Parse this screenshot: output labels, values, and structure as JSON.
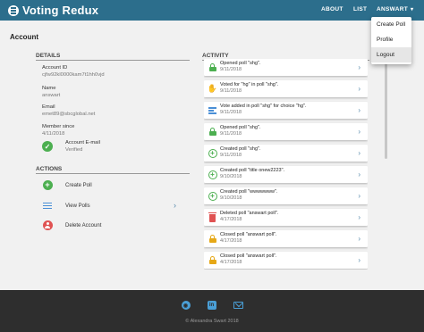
{
  "navbar": {
    "brand": "Voting Redux",
    "links": {
      "about": "ABOUT",
      "list": "LIST",
      "user": "ANSWART"
    }
  },
  "dropdown": {
    "items": [
      "Create Poll",
      "Profile",
      "Logout"
    ],
    "active_item": "Logout"
  },
  "page": {
    "title": "Account"
  },
  "details": {
    "header": "DETAILS",
    "account_id_label": "Account ID",
    "account_id_value": "cjfw92kl0000kam7t1hh0vjd",
    "name_label": "Name",
    "name_value": "answart",
    "email_label": "Email",
    "email_value": "emet89@sbcglobal.net",
    "member_since_label": "Member since",
    "member_since_value": "4/11/2018",
    "email_status_label": "Account E-mail",
    "email_status_value": "Verified"
  },
  "actions": {
    "header": "ACTIONS",
    "items": [
      {
        "label": "Create Poll",
        "icon": "plus-circle-icon"
      },
      {
        "label": "View Polls",
        "icon": "list-icon"
      },
      {
        "label": "Delete Account",
        "icon": "account-remove-icon"
      }
    ]
  },
  "activity": {
    "header": "ACTIVITY",
    "items": [
      {
        "title": "Opened poll \"shg\".",
        "date": "9/11/2018",
        "icon": "lock-open-icon"
      },
      {
        "title": "Voted for \"hg\" in poll \"shg\".",
        "date": "9/11/2018",
        "icon": "vote-hand-icon"
      },
      {
        "title": "Vote added in poll \"shg\" for choice \"hg\".",
        "date": "9/11/2018",
        "icon": "text-lines-icon"
      },
      {
        "title": "Opened poll \"shg\".",
        "date": "9/11/2018",
        "icon": "lock-open-icon"
      },
      {
        "title": "Created poll \"shg\".",
        "date": "9/11/2018",
        "icon": "add-circle-icon"
      },
      {
        "title": "Created poll \"title onew2223\".",
        "date": "9/10/2018",
        "icon": "add-circle-icon"
      },
      {
        "title": "Created poll \"wwwwwww\".",
        "date": "9/10/2018",
        "icon": "add-circle-icon"
      },
      {
        "title": "Deleted poll \"answart poll\".",
        "date": "4/17/2018",
        "icon": "trash-icon"
      },
      {
        "title": "Closed poll \"answart poll\".",
        "date": "4/17/2018",
        "icon": "lock-icon"
      },
      {
        "title": "Closed poll \"answart poll\".",
        "date": "4/17/2018",
        "icon": "lock-icon"
      }
    ]
  },
  "footer": {
    "icons": [
      "github-icon",
      "linkedin-icon",
      "mail-icon"
    ],
    "copyright": "© Alexandra Swart 2018"
  },
  "colors": {
    "navbar": "#2c6e8c",
    "footer": "#2e2e2e",
    "green": "#4caf50",
    "red": "#e05252",
    "amber": "#e6a817",
    "link": "#4a9fd6"
  }
}
